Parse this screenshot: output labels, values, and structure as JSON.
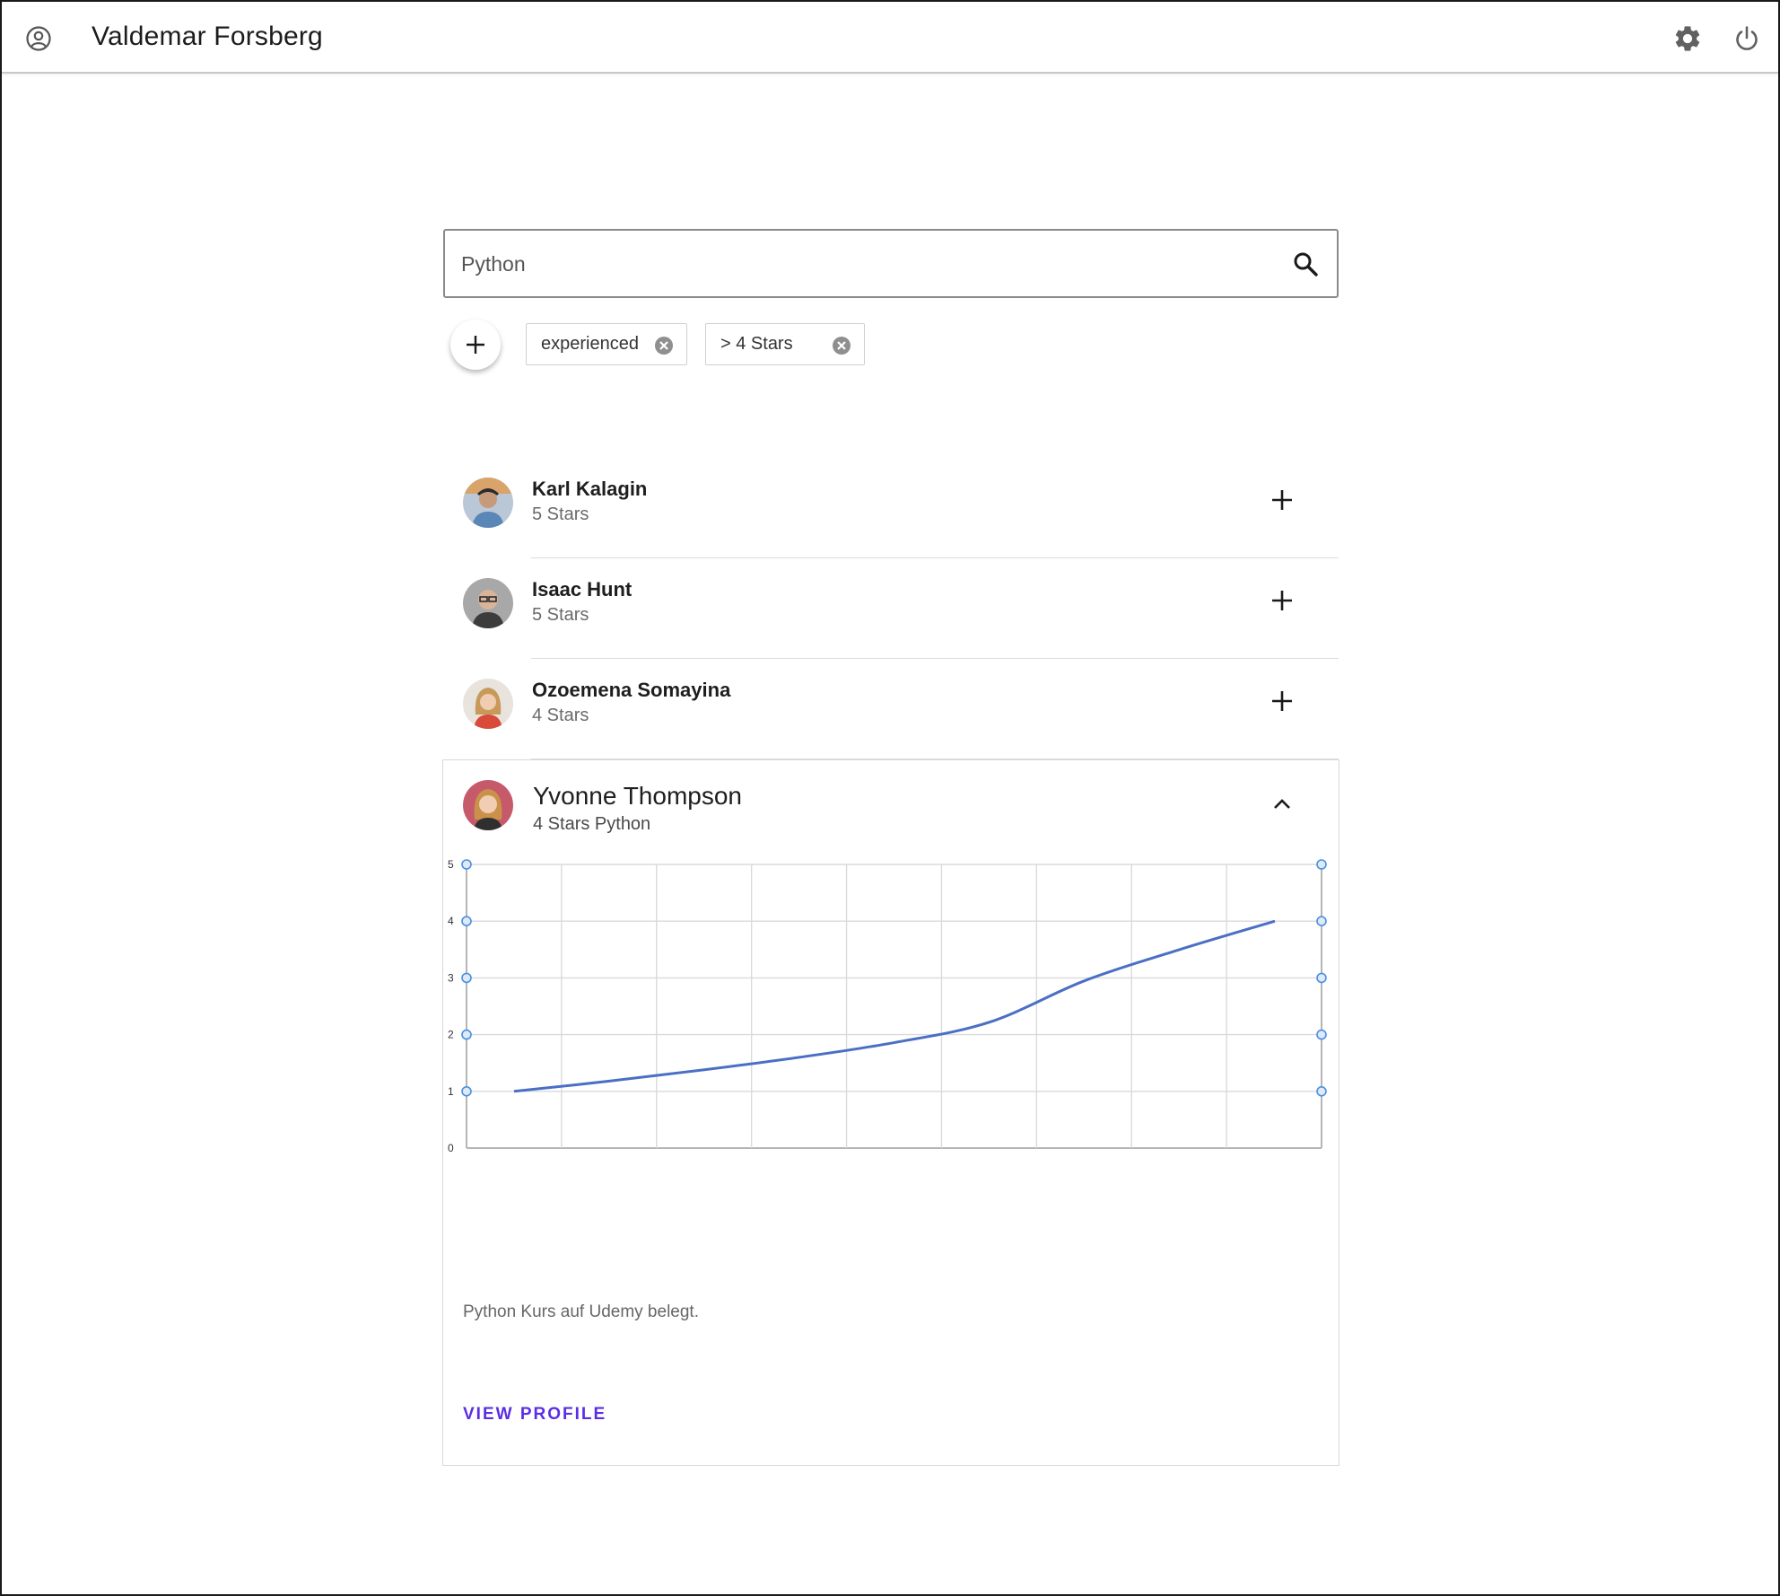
{
  "header": {
    "user_name": "Valdemar Forsberg",
    "icons": [
      "account-circle-icon",
      "gear-icon",
      "power-icon"
    ]
  },
  "search": {
    "value": "Python",
    "icon": "search-icon"
  },
  "filters": [
    {
      "label": "experienced"
    },
    {
      "label": "> 4 Stars"
    }
  ],
  "results": [
    {
      "name": "Karl Kalagin",
      "rating": "5 Stars"
    },
    {
      "name": "Isaac Hunt",
      "rating": "5 Stars"
    },
    {
      "name": "Ozoemena Somayina",
      "rating": "4 Stars"
    }
  ],
  "expanded": {
    "name": "Yvonne Thompson",
    "subtitle": "4 Stars Python",
    "description": "Python Kurs auf Udemy belegt.",
    "view_profile": "VIEW PROFILE"
  },
  "chart_data": {
    "type": "line",
    "y_ticks": [
      "0",
      "1",
      "2",
      "3",
      "4",
      "5"
    ],
    "ylim": [
      0,
      5
    ],
    "x_count": 9,
    "grid": true,
    "series": [
      {
        "color": "#4a6fc4",
        "values": [
          1.0,
          1.18,
          1.38,
          1.6,
          1.86,
          2.22,
          2.95,
          3.5,
          4.0
        ]
      }
    ]
  },
  "colors": {
    "accent": "#5b2de6",
    "line": "#4a6fc4",
    "handle": "#4a90e2"
  }
}
